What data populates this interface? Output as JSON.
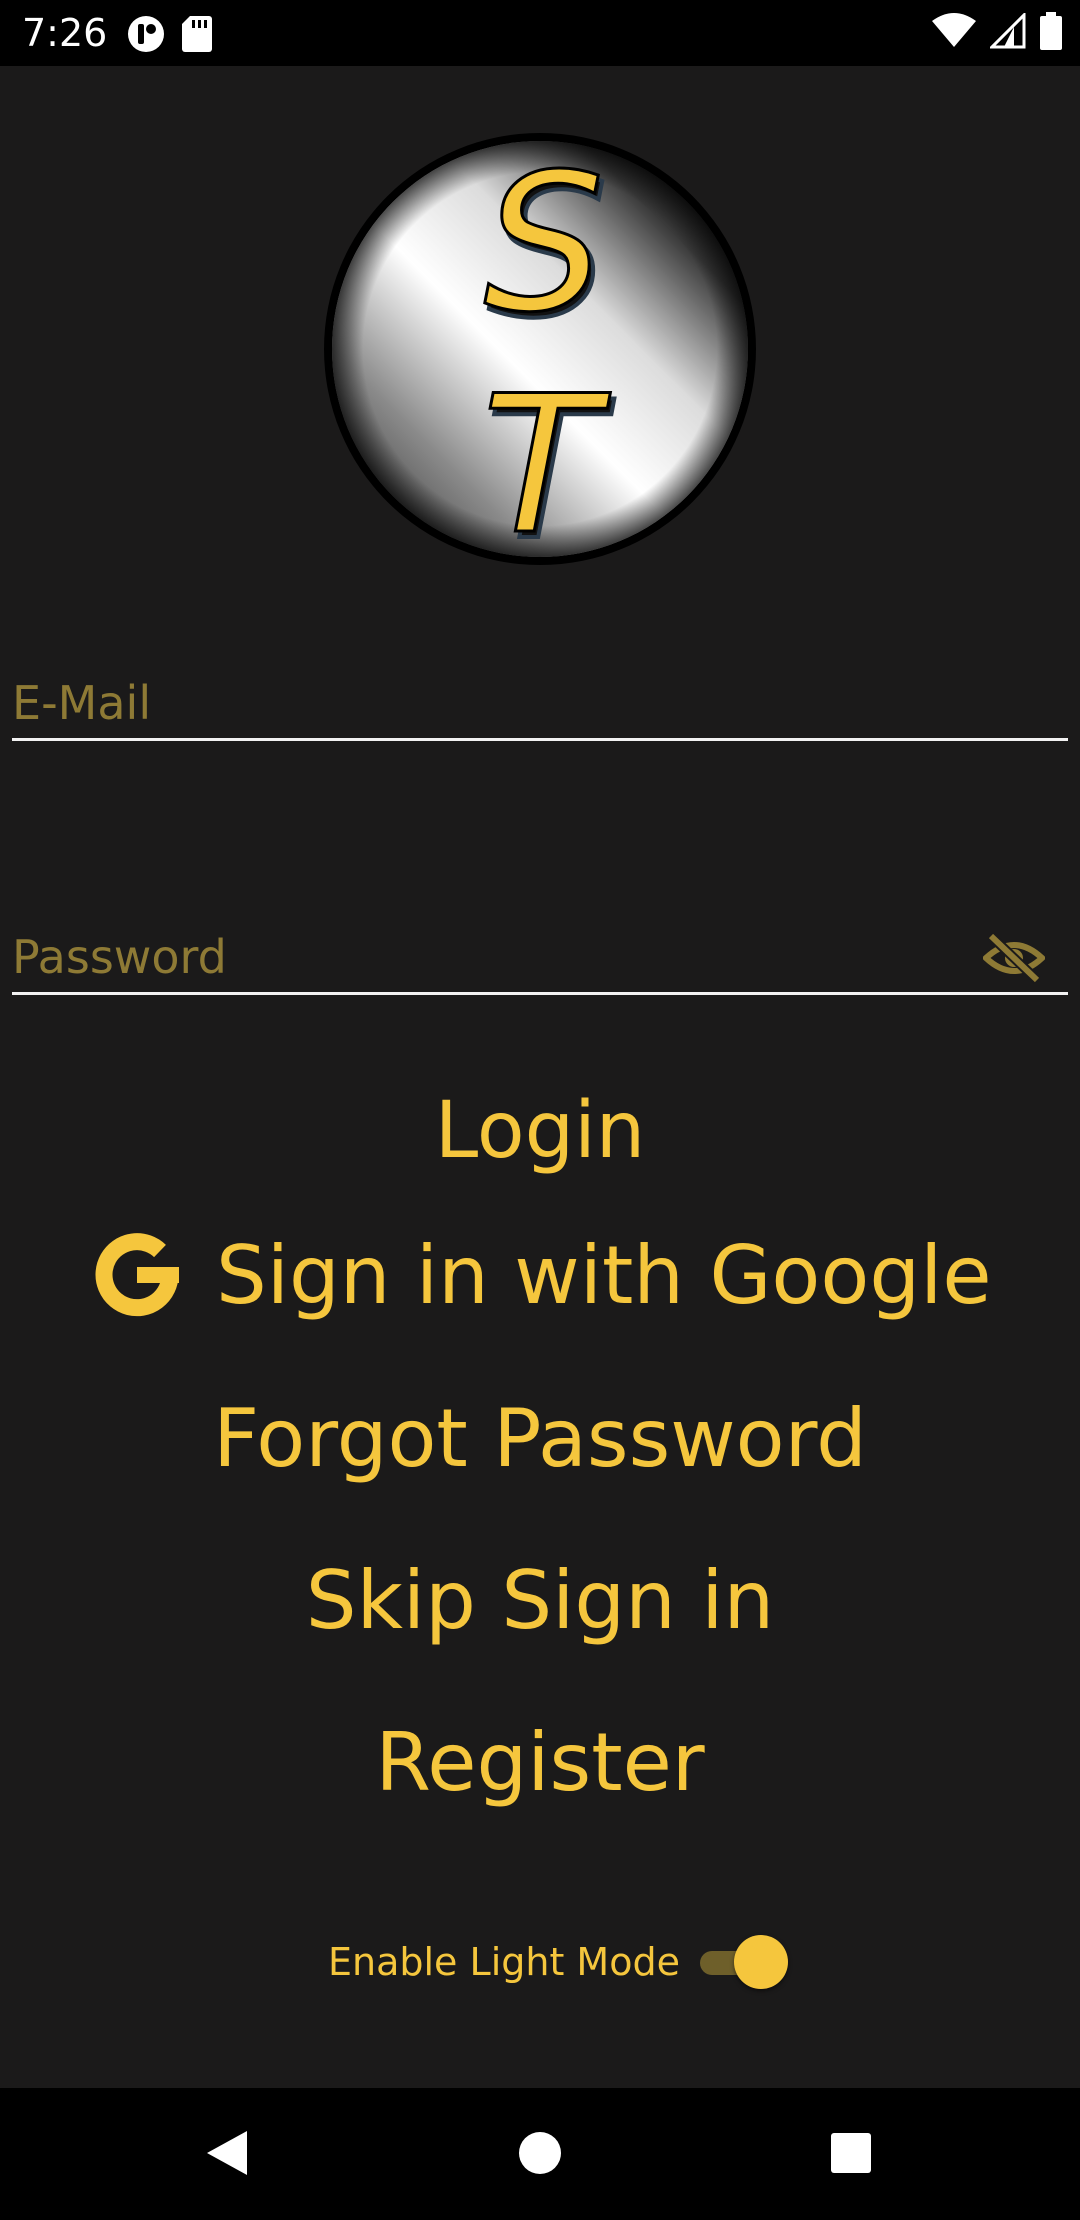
{
  "status_bar": {
    "time": "7:26",
    "icons": [
      "app-notification-icon",
      "sd-card-icon",
      "wifi-icon",
      "cell-signal-icon",
      "battery-icon"
    ]
  },
  "logo": {
    "letters": "S T",
    "accent": "#f5c63d"
  },
  "form": {
    "email_placeholder": "E-Mail",
    "email_value": "",
    "password_placeholder": "Password",
    "password_value": ""
  },
  "actions": {
    "login_label": "Login",
    "google_label": "Sign in with Google",
    "forgot_label": "Forgot Password",
    "skip_label": "Skip Sign in",
    "register_label": "Register"
  },
  "settings": {
    "light_mode_label": "Enable Light Mode",
    "light_mode_enabled": true
  },
  "colors": {
    "background": "#1b1a1a",
    "accent": "#f5c63d",
    "placeholder": "#8e7a35"
  }
}
